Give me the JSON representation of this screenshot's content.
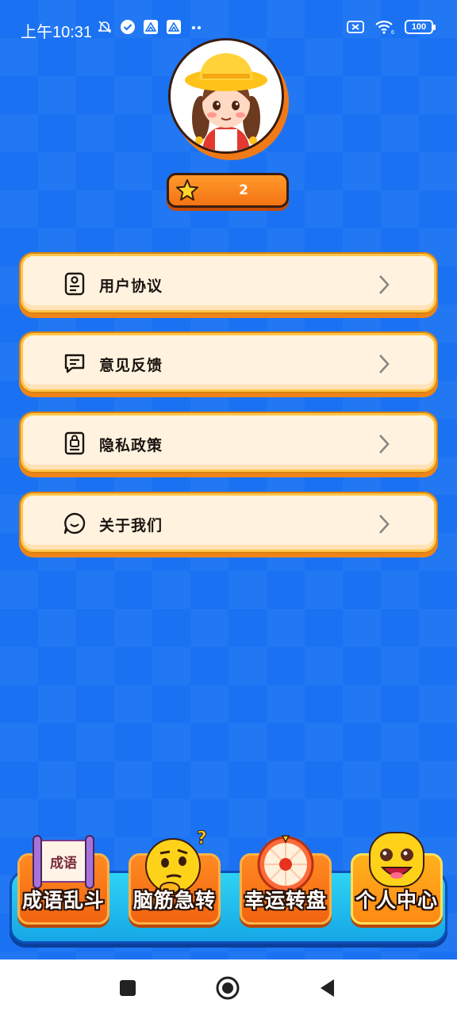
{
  "status_bar": {
    "time": "上午10:31",
    "battery": "100"
  },
  "profile": {
    "score": "2"
  },
  "menu": [
    {
      "label": "用户协议",
      "icon": "document-user-icon"
    },
    {
      "label": "意见反馈",
      "icon": "message-icon"
    },
    {
      "label": "隐私政策",
      "icon": "lock-document-icon"
    },
    {
      "label": "关于我们",
      "icon": "chat-smile-icon"
    }
  ],
  "tabs": [
    {
      "label": "成语乱斗",
      "icon": "scroll-icon",
      "badge": "成语"
    },
    {
      "label": "脑筋急转",
      "icon": "thinking-emoji-icon"
    },
    {
      "label": "幸运转盘",
      "icon": "wheel-icon"
    },
    {
      "label": "个人中心",
      "icon": "smiley-emoji-icon",
      "active": true
    }
  ],
  "colors": {
    "background": "#1a72f3",
    "accent_orange": "#f47414",
    "card": "#fff3e0",
    "card_border": "#ffc64a"
  }
}
